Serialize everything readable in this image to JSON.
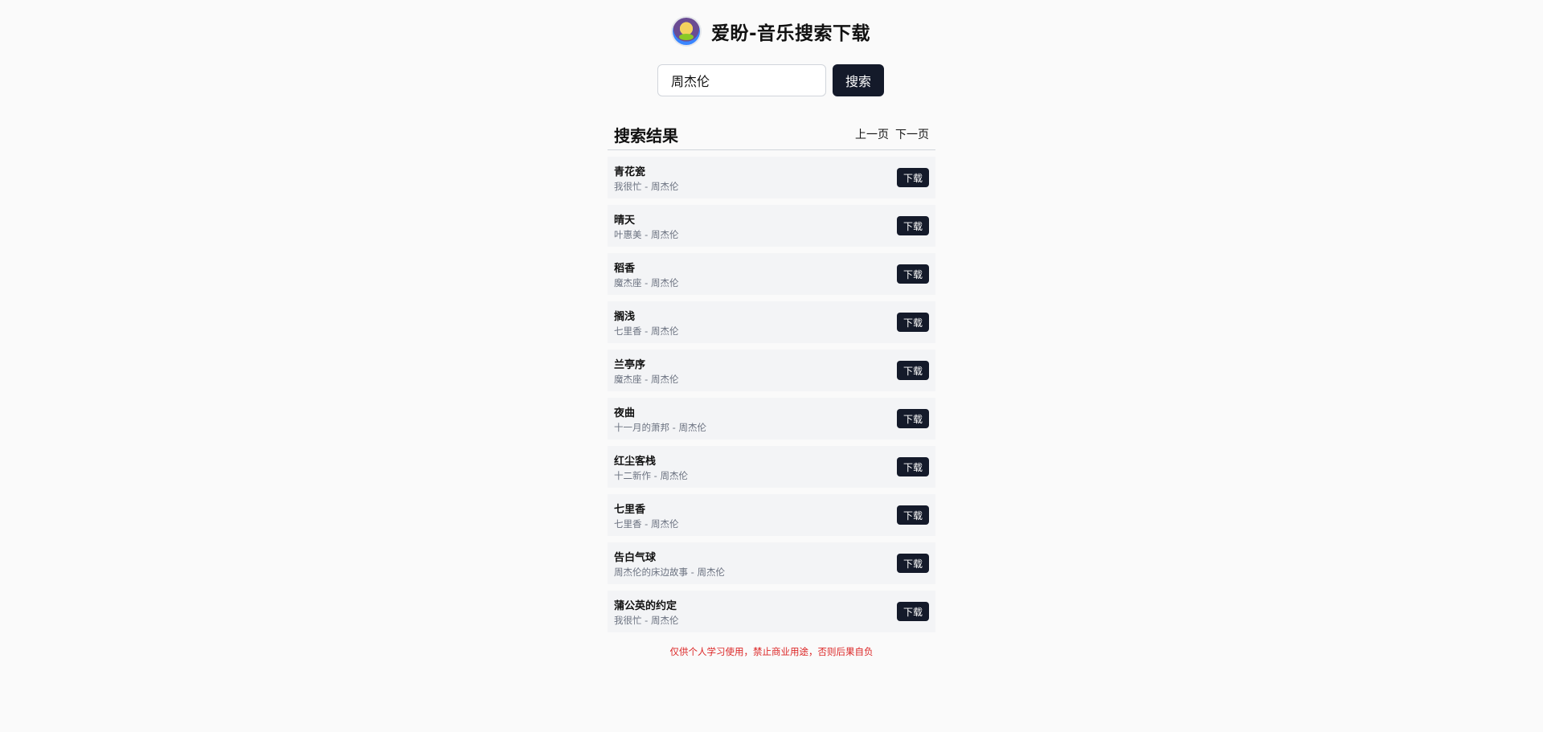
{
  "header": {
    "title": "爱盼-音乐搜索下载",
    "logo_icon": "cartoon-avatar-icon"
  },
  "search": {
    "value": "周杰伦",
    "button_label": "搜索"
  },
  "results": {
    "title": "搜索结果",
    "prev_label": "上一页",
    "next_label": "下一页",
    "items": [
      {
        "song": "青花瓷",
        "meta": "我很忙 - 周杰伦",
        "button": "下载"
      },
      {
        "song": "晴天",
        "meta": "叶惠美 - 周杰伦",
        "button": "下载"
      },
      {
        "song": "稻香",
        "meta": "魔杰座 - 周杰伦",
        "button": "下载"
      },
      {
        "song": "搁浅",
        "meta": "七里香 - 周杰伦",
        "button": "下载"
      },
      {
        "song": "兰亭序",
        "meta": "魔杰座 - 周杰伦",
        "button": "下载"
      },
      {
        "song": "夜曲",
        "meta": "十一月的萧邦 - 周杰伦",
        "button": "下载"
      },
      {
        "song": "红尘客栈",
        "meta": "十二新作 - 周杰伦",
        "button": "下载"
      },
      {
        "song": "七里香",
        "meta": "七里香 - 周杰伦",
        "button": "下载"
      },
      {
        "song": "告白气球",
        "meta": "周杰伦的床边故事 - 周杰伦",
        "button": "下载"
      },
      {
        "song": "蒲公英的约定",
        "meta": "我很忙 - 周杰伦",
        "button": "下载"
      }
    ]
  },
  "footer": {
    "notice": "仅供个人学习使用，禁止商业用途，否则后果自负"
  },
  "colors": {
    "primary_button": "#141a2a",
    "notice": "#dc2626",
    "item_background": "#f3f4f6"
  }
}
